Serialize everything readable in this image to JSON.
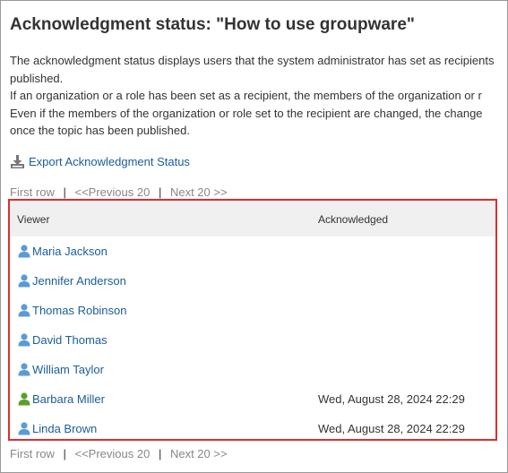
{
  "page_title": "Acknowledgment status: \"How to use groupware\"",
  "description": [
    "The acknowledgment status displays users that the system administrator has set as recipients",
    "published.",
    "If an organization or a role has been set as a recipient, the members of the organization or r",
    "Even if the members of the organization or role set to the recipient are changed, the change",
    "once the topic has been published."
  ],
  "export": {
    "icon": "download-icon",
    "label": "Export Acknowledgment Status"
  },
  "pager": {
    "first": "First row",
    "previous": "<<Previous 20",
    "next": "Next 20 >>",
    "separator": "|"
  },
  "table": {
    "columns": {
      "viewer": "Viewer",
      "acknowledged": "Acknowledged"
    },
    "rows": [
      {
        "viewer": "Maria Jackson",
        "acknowledged": "",
        "icon_color": "#5b9bd5"
      },
      {
        "viewer": "Jennifer Anderson",
        "acknowledged": "",
        "icon_color": "#5b9bd5"
      },
      {
        "viewer": "Thomas Robinson",
        "acknowledged": "",
        "icon_color": "#5b9bd5"
      },
      {
        "viewer": "David Thomas",
        "acknowledged": "",
        "icon_color": "#5b9bd5"
      },
      {
        "viewer": "William Taylor",
        "acknowledged": "",
        "icon_color": "#5b9bd5"
      },
      {
        "viewer": "Barbara Miller",
        "acknowledged": "Wed, August 28, 2024 22:29",
        "icon_color": "#5a9e2e"
      },
      {
        "viewer": "Linda Brown",
        "acknowledged": "Wed, August 28, 2024 22:29",
        "icon_color": "#5b9bd5"
      }
    ]
  },
  "colors": {
    "link": "#1a5d9c",
    "highlight_border": "#d9302c",
    "header_bg": "#f0f0f0",
    "pager_disabled": "#888888"
  }
}
